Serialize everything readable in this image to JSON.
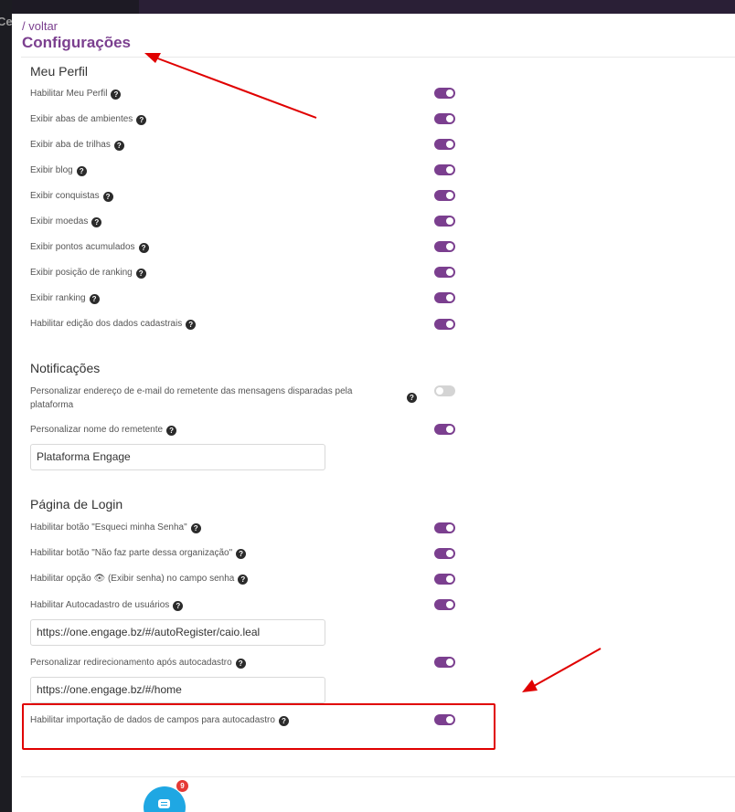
{
  "background": {
    "left_glyph": "Ce"
  },
  "header": {
    "back_link": "/ voltar",
    "title": "Configurações"
  },
  "colors": {
    "accent": "#7b3f8f",
    "toggle_off": "#d4d4d4",
    "annotation": "#e00000",
    "chat": "#1fa7e3",
    "badge": "#e53935"
  },
  "help_icon_glyph": "?",
  "meu_perfil": {
    "title": "Meu Perfil",
    "items": [
      {
        "label": "Habilitar Meu Perfil",
        "enabled": true
      },
      {
        "label": "Exibir abas de ambientes",
        "enabled": true
      },
      {
        "label": "Exibir aba de trilhas",
        "enabled": true
      },
      {
        "label": "Exibir blog",
        "enabled": true
      },
      {
        "label": "Exibir conquistas",
        "enabled": true
      },
      {
        "label": "Exibir moedas",
        "enabled": true
      },
      {
        "label": "Exibir pontos acumulados",
        "enabled": true
      },
      {
        "label": "Exibir posição de ranking",
        "enabled": true
      },
      {
        "label": "Exibir ranking",
        "enabled": true
      },
      {
        "label": "Habilitar edição dos dados cadastrais",
        "enabled": true
      }
    ]
  },
  "notificacoes": {
    "title": "Notificações",
    "items": [
      {
        "label": "Personalizar endereço de e-mail do remetente das mensagens disparadas pela plataforma",
        "enabled": false
      },
      {
        "label": "Personalizar nome do remetente",
        "enabled": true,
        "input_value": "Plataforma Engage"
      }
    ]
  },
  "pagina_login": {
    "title": "Página de Login",
    "items": [
      {
        "label": "Habilitar botão \"Esqueci minha Senha\"",
        "enabled": true
      },
      {
        "label": "Habilitar botão \"Não faz parte dessa organização\"",
        "enabled": true
      },
      {
        "label": "Habilitar opção 👁 (Exibir senha) no campo senha",
        "enabled": true
      },
      {
        "label": "Habilitar Autocadastro de usuários",
        "enabled": true,
        "input_value": "https://one.engage.bz/#/autoRegister/caio.leal"
      },
      {
        "label": "Personalizar redirecionamento após autocadastro",
        "enabled": true,
        "input_value": "https://one.engage.bz/#/home"
      },
      {
        "label": "Habilitar importação de dados de campos para autocadastro",
        "enabled": true
      }
    ]
  },
  "chat_widget": {
    "icon": "chat-icon",
    "badge_count": "9"
  }
}
